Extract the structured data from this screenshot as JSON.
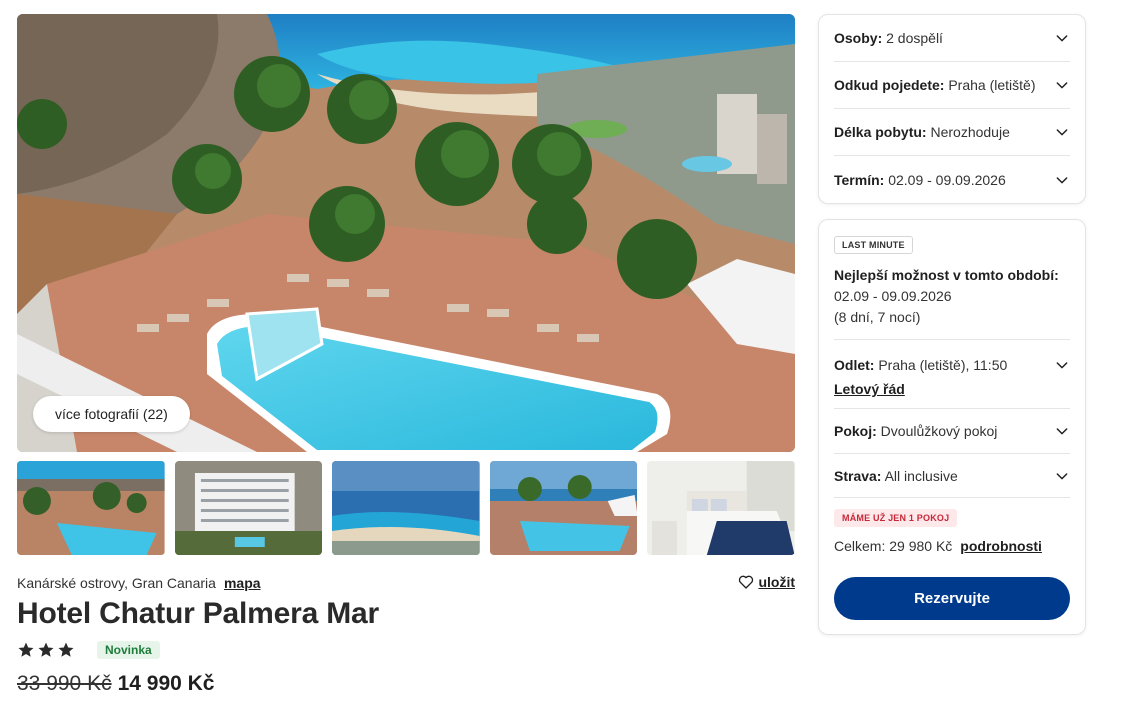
{
  "gallery": {
    "more_photos_label": "více fotografií (22)"
  },
  "hotel": {
    "location": "Kanárské ostrovy, Gran Canaria",
    "map_label": "mapa",
    "save_label": "uložit",
    "name": "Hotel Chatur Palmera Mar",
    "stars": 3,
    "badge": "Novinka",
    "price_old": "33 990 Kč",
    "price_new": "14 990 Kč"
  },
  "filters": {
    "persons": {
      "label": "Osoby:",
      "value": "2 dospělí"
    },
    "departure": {
      "label": "Odkud pojedete:",
      "value": "Praha (letiště)"
    },
    "length": {
      "label": "Délka pobytu:",
      "value": "Nerozhoduje"
    },
    "date": {
      "label": "Termín:",
      "value": "02.09 - 09.09.2026"
    }
  },
  "offer": {
    "badge": "LAST MINUTE",
    "best_title": "Nejlepší možnost v tomto období:",
    "best_dates": "02.09 - 09.09.2026",
    "best_nights": "(8 dní, 7 nocí)",
    "flight_label": "Odlet:",
    "flight_value": "Praha (letiště), 11:50",
    "flight_link": "Letový řád",
    "room_label": "Pokoj:",
    "room_value": "Dvoulůžkový pokoj",
    "board_label": "Strava:",
    "board_value": "All inclusive",
    "alert": "MÁME UŽ JEN 1 POKOJ",
    "total_label": "Celkem: 29 980 Kč",
    "details_link": "podrobnosti",
    "book_button": "Rezervujte"
  },
  "colors": {
    "primary": "#003a8c",
    "badge_new_bg": "#e6f4ea",
    "badge_new_fg": "#1e7d3a",
    "alert_bg": "#fde8ea",
    "alert_fg": "#c8283a"
  }
}
